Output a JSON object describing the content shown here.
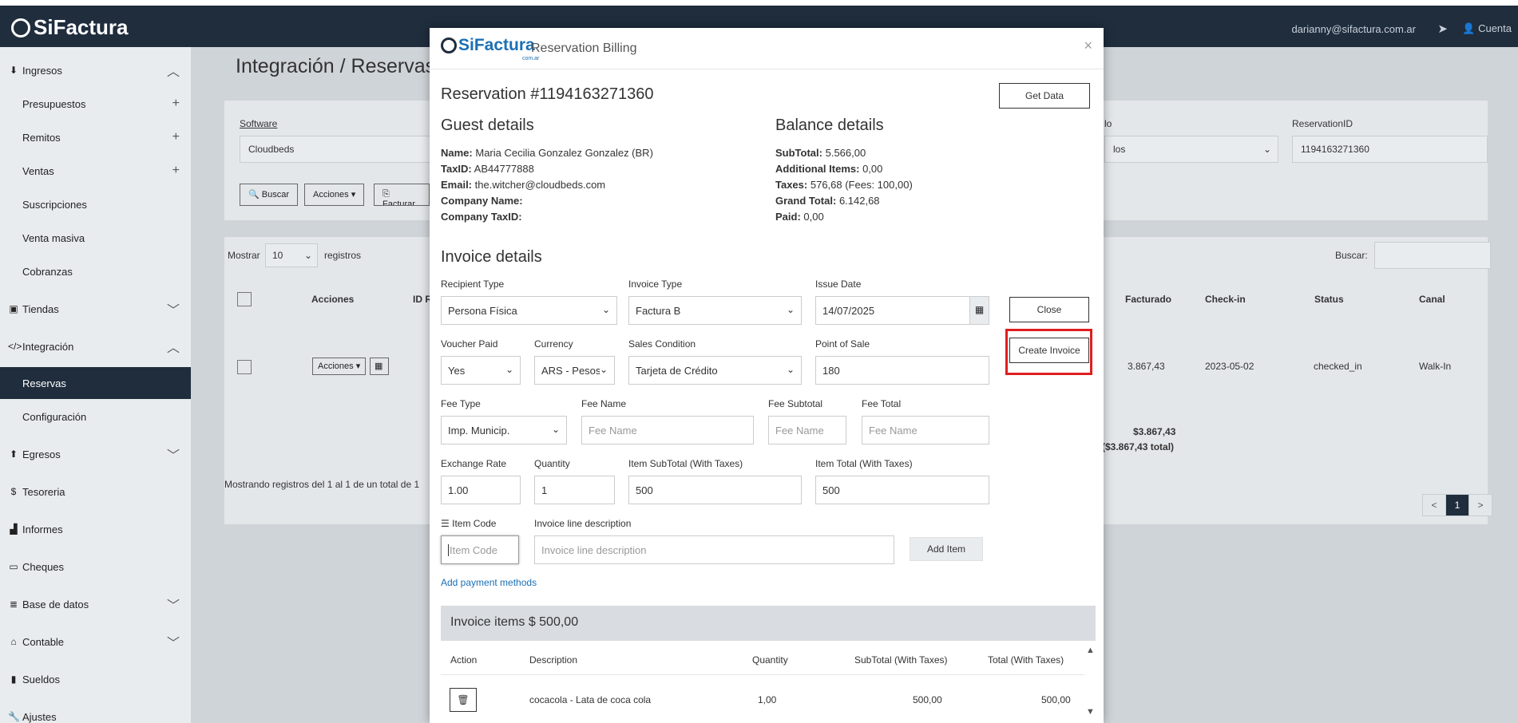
{
  "app": {
    "brand": "SiFactura",
    "user_email": "darianny@sifactura.com.ar",
    "account_label": "Cuenta"
  },
  "sidebar": {
    "items": [
      {
        "label": "Ingresos",
        "icon": "download-icon"
      },
      {
        "label": "Presupuestos"
      },
      {
        "label": "Remitos"
      },
      {
        "label": "Ventas"
      },
      {
        "label": "Suscripciones"
      },
      {
        "label": "Venta masiva"
      },
      {
        "label": "Cobranzas"
      },
      {
        "label": "Tiendas",
        "icon": "store-icon"
      },
      {
        "label": "Integración",
        "icon": "code-icon"
      },
      {
        "label": "Reservas"
      },
      {
        "label": "Configuración"
      },
      {
        "label": "Egresos",
        "icon": "upload-icon"
      },
      {
        "label": "Tesoreria",
        "icon": "dollar-icon"
      },
      {
        "label": "Informes",
        "icon": "chart-icon"
      },
      {
        "label": "Cheques",
        "icon": "card-icon"
      },
      {
        "label": "Base de datos",
        "icon": "database-icon"
      },
      {
        "label": "Contable",
        "icon": "bank-icon"
      },
      {
        "label": "Sueldos",
        "icon": "book-icon"
      },
      {
        "label": "Ajustes",
        "icon": "wrench-icon"
      }
    ]
  },
  "background": {
    "breadcrumb": "Integración  /  Reservas",
    "software_label": "Software",
    "software_value": "Cloudbeds",
    "status_label_partial": "lo",
    "status_value_partial": "los",
    "reservation_id_label": "ReservationID",
    "reservation_id_value": "1194163271360",
    "buttons": {
      "search": "Buscar",
      "actions": "Acciones",
      "invoice": "Facturar"
    },
    "show_label": "Mostrar",
    "show_value": "10",
    "records_label": "registros",
    "search_label": "Buscar:",
    "columns": {
      "actions": "Acciones",
      "id": "ID R",
      "invoiced": "Facturado",
      "checkin": "Check-in",
      "status": "Status",
      "channel": "Canal"
    },
    "row": {
      "actions": "Acciones",
      "invoiced": "3.867,43",
      "checkin": "2023-05-02",
      "status": "checked_in",
      "channel": "Walk-In"
    },
    "totals": {
      "line1": "$3.867,43",
      "line2": "($3.867,43 total)"
    },
    "showing": "Mostrando registros del 1 al 1 de un total de 1",
    "pager": {
      "prev": "<",
      "page": "1",
      "next": ">"
    }
  },
  "modal": {
    "logo_text": "SiFactura",
    "logo_sub": "com.ar",
    "title": "Reservation Billing",
    "reservation": "Reservation #1194163271360",
    "get_data": "Get Data",
    "guest": {
      "heading": "Guest details",
      "name_label": "Name:",
      "name": "Maria Cecilia Gonzalez Gonzalez (BR)",
      "taxid_label": "TaxID:",
      "taxid": "AB44777888",
      "email_label": "Email:",
      "email": "the.witcher@cloudbeds.com",
      "company_label": "Company Name:",
      "company": "",
      "company_taxid_label": "Company TaxID:",
      "company_taxid": ""
    },
    "balance": {
      "heading": "Balance details",
      "subtotal_label": "SubTotal:",
      "subtotal": "5.566,00",
      "additional_label": "Additional Items:",
      "additional": "0,00",
      "taxes_label": "Taxes:",
      "taxes": "576,68 (Fees: 100,00)",
      "grand_label": "Grand Total:",
      "grand": "6.142,68",
      "paid_label": "Paid:",
      "paid": "0,00"
    },
    "invoice": {
      "heading": "Invoice details",
      "recipient_type_label": "Recipient Type",
      "recipient_type": "Persona Física",
      "invoice_type_label": "Invoice Type",
      "invoice_type": "Factura B",
      "issue_date_label": "Issue Date",
      "issue_date": "14/07/2025",
      "close": "Close",
      "create_invoice": "Create Invoice",
      "voucher_paid_label": "Voucher Paid",
      "voucher_paid": "Yes",
      "currency_label": "Currency",
      "currency": "ARS - Pesos",
      "sales_condition_label": "Sales Condition",
      "sales_condition": "Tarjeta de Crédito",
      "point_of_sale_label": "Point of Sale",
      "point_of_sale": "180",
      "fee_type_label": "Fee Type",
      "fee_type": "Imp. Municip.",
      "fee_name_label": "Fee Name",
      "fee_name_ph": "Fee Name",
      "fee_subtotal_label": "Fee Subtotal",
      "fee_subtotal_ph": "Fee Name",
      "fee_total_label": "Fee Total",
      "fee_total_ph": "Fee Name",
      "exchange_rate_label": "Exchange Rate",
      "exchange_rate": "1.00",
      "quantity_label": "Quantity",
      "quantity": "1",
      "item_subtotal_label": "Item SubTotal (With Taxes)",
      "item_subtotal": "500",
      "item_total_label": "Item Total (With Taxes)",
      "item_total": "500",
      "item_code_label": "Item Code",
      "item_code_ph": "Item Code",
      "line_desc_label": "Invoice line description",
      "line_desc_ph": "Invoice line description",
      "add_item": "Add Item",
      "add_payment": "Add payment methods"
    },
    "items": {
      "heading": "Invoice items $ 500,00",
      "columns": {
        "action": "Action",
        "description": "Description",
        "quantity": "Quantity",
        "subtotal": "SubTotal (With Taxes)",
        "total": "Total (With Taxes)"
      },
      "rows": [
        {
          "description": "cocacola - Lata de coca cola",
          "quantity": "1,00",
          "subtotal": "500,00",
          "total": "500,00"
        }
      ]
    }
  },
  "colors": {
    "navbar": "#1f2d3d",
    "accent": "#1a6fb5",
    "highlight": "#e01e1e"
  }
}
